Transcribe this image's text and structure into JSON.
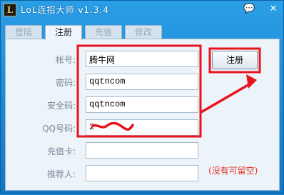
{
  "window": {
    "title": "LoL连招大师 v1.3.4",
    "icon_letter": "L",
    "help_glyph": "💬",
    "close_glyph": "✕"
  },
  "tabs": [
    {
      "label": "登陆",
      "active": false
    },
    {
      "label": "注册",
      "active": true
    },
    {
      "label": "充值",
      "active": false
    },
    {
      "label": "修改",
      "active": false
    }
  ],
  "form": {
    "account_label": "帐号:",
    "account_value": "腾牛网",
    "password_label": "密码:",
    "password_value": "qqtncom",
    "security_label": "安全码:",
    "security_value": "qqtncom",
    "qq_label": "QQ号码:",
    "qq_value": "2",
    "card_label": "充值卡:",
    "card_value": "",
    "referrer_label": "推荐人:",
    "referrer_value": "",
    "referrer_hint": "(没有可留空)"
  },
  "register_button": "注册",
  "colors": {
    "annotation_red": "#e8141c",
    "hint_red": "#e53424",
    "title_blue": "#1e8fd6"
  }
}
